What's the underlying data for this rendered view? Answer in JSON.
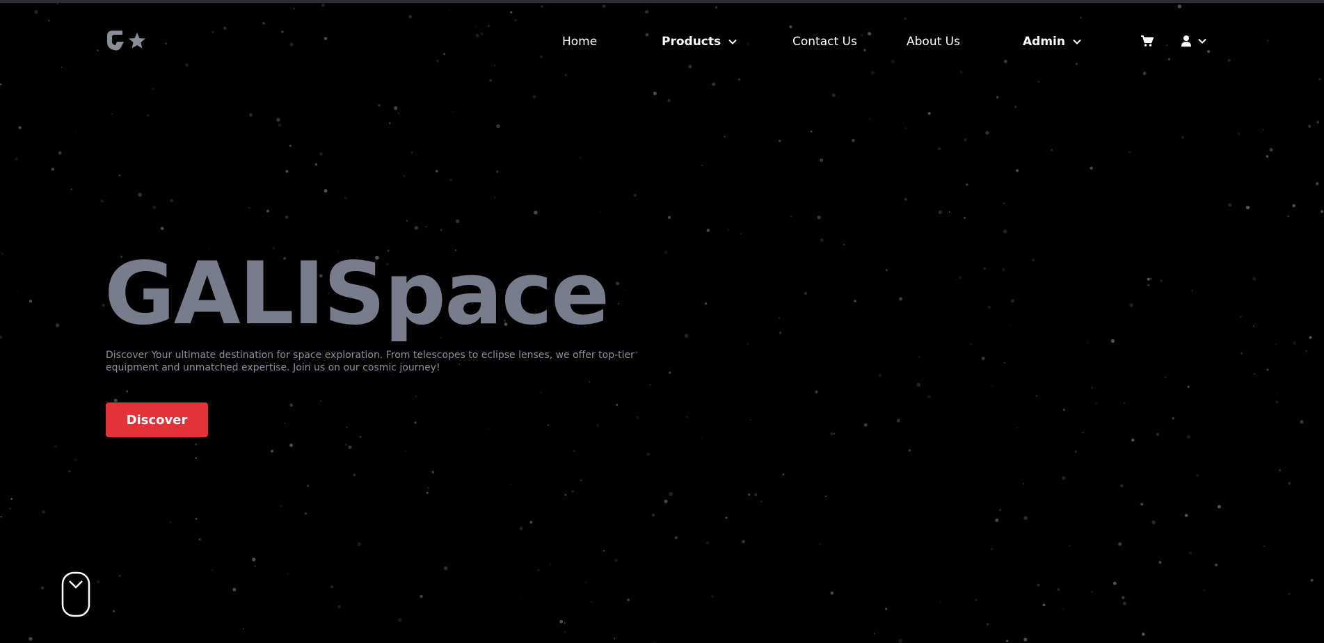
{
  "header": {
    "logo_alt": "G*",
    "nav": {
      "home": "Home",
      "products": "Products",
      "contact": "Contact Us",
      "about": "About Us",
      "admin": "Admin"
    },
    "icons": {
      "cart": "cart-icon",
      "user": "user-icon",
      "chevron": "chevron-down-icon"
    }
  },
  "hero": {
    "title": "GALISpace",
    "description": "Discover Your ultimate destination for space exploration. From telescopes to eclipse lenses, we offer top-tier equipment and unmatched expertise. Join us on our cosmic journey!",
    "cta_label": "Discover"
  },
  "colors": {
    "background": "#000000",
    "title": "#787c8c",
    "cta": "#e3323a",
    "nav_text": "#ffffff"
  }
}
